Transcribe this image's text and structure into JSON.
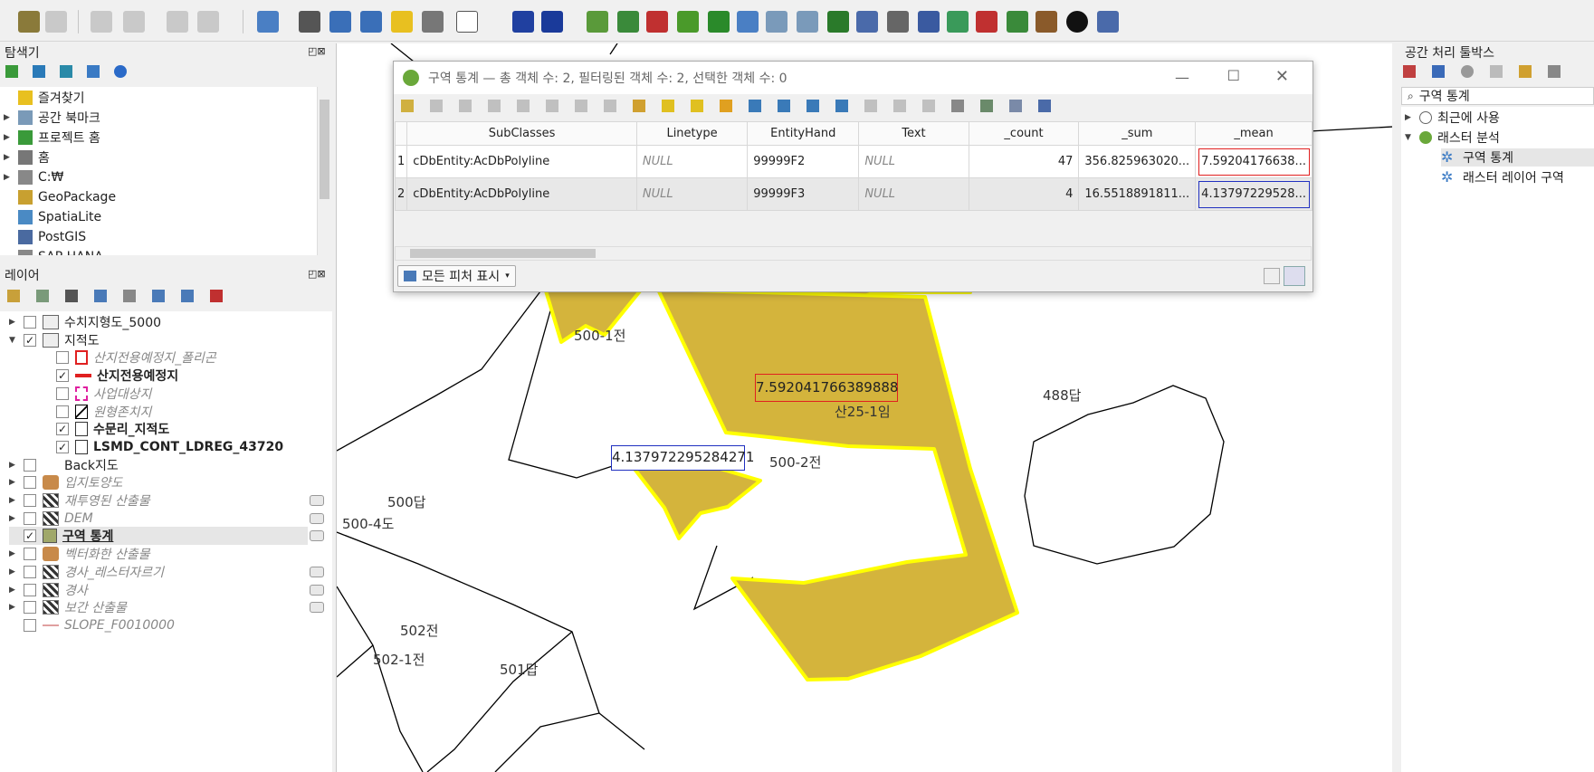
{
  "explorer": {
    "title": "탐색기",
    "items": [
      {
        "label": "즐겨찾기",
        "arrow": ""
      },
      {
        "label": "공간 북마크",
        "arrow": "▶"
      },
      {
        "label": "프로젝트 홈",
        "arrow": "▶"
      },
      {
        "label": "홈",
        "arrow": "▶"
      },
      {
        "label": "C:₩",
        "arrow": "▶"
      },
      {
        "label": "GeoPackage",
        "arrow": ""
      },
      {
        "label": "SpatiaLite",
        "arrow": ""
      },
      {
        "label": "PostGIS",
        "arrow": ""
      },
      {
        "label": "SAP HANA",
        "arrow": ""
      }
    ]
  },
  "layers": {
    "title": "레이어",
    "items": [
      {
        "label": "수치지형도_5000",
        "arrow": "▶",
        "checked": "",
        "indent": 0,
        "style": "normal",
        "icon": "group-icon"
      },
      {
        "label": "지적도",
        "arrow": "▼",
        "checked": "✓",
        "indent": 0,
        "style": "normal",
        "icon": "group-icon"
      },
      {
        "label": "산지전용예정지_폴리곤",
        "arrow": "",
        "checked": "",
        "indent": 1,
        "style": "it",
        "icon": "red-polygon-icon"
      },
      {
        "label": "산지전용예정지",
        "arrow": "",
        "checked": "✓",
        "indent": 1,
        "style": "bold",
        "icon": "red-line-icon"
      },
      {
        "label": "사업대상지",
        "arrow": "",
        "checked": "",
        "indent": 1,
        "style": "it",
        "icon": "pink-dashed-icon"
      },
      {
        "label": "원형존치지",
        "arrow": "",
        "checked": "",
        "indent": 1,
        "style": "it",
        "icon": "hatched-polygon-icon"
      },
      {
        "label": "수문리_지적도",
        "arrow": "",
        "checked": "✓",
        "indent": 1,
        "style": "bold",
        "icon": "empty-polygon-icon"
      },
      {
        "label": "LSMD_CONT_LDREG_43720",
        "arrow": "",
        "checked": "✓",
        "indent": 1,
        "style": "bold",
        "icon": "empty-polygon-icon"
      },
      {
        "label": "Back지도",
        "arrow": "▶",
        "checked": "",
        "indent": 0,
        "style": "normal",
        "icon": "none"
      },
      {
        "label": "입지토양도",
        "arrow": "▶",
        "checked": "",
        "indent": 0,
        "style": "it",
        "icon": "vector-icon"
      },
      {
        "label": "재투영된 산출물",
        "arrow": "▶",
        "checked": "",
        "indent": 0,
        "style": "it",
        "icon": "raster-icon"
      },
      {
        "label": "DEM",
        "arrow": "▶",
        "checked": "",
        "indent": 0,
        "style": "it",
        "icon": "raster-icon"
      },
      {
        "label": "구역 통계",
        "arrow": "",
        "checked": "✓",
        "indent": 0,
        "style": "bold-ul",
        "icon": "olive-fill-icon"
      },
      {
        "label": "벡터화한 산출물",
        "arrow": "▶",
        "checked": "",
        "indent": 0,
        "style": "it",
        "icon": "vector-icon"
      },
      {
        "label": "경사_레스터자르기",
        "arrow": "▶",
        "checked": "",
        "indent": 0,
        "style": "it",
        "icon": "raster-icon"
      },
      {
        "label": "경사",
        "arrow": "▶",
        "checked": "",
        "indent": 0,
        "style": "it",
        "icon": "raster-icon"
      },
      {
        "label": "보간 산출물",
        "arrow": "▶",
        "checked": "",
        "indent": 0,
        "style": "it",
        "icon": "raster-icon"
      },
      {
        "label": "SLOPE_F0010000",
        "arrow": "",
        "checked": "",
        "indent": 0,
        "style": "it",
        "icon": "line-icon"
      }
    ]
  },
  "dialog": {
    "title": "구역 통계 — 총 객체 수: 2, 필터링된 객체 수: 2, 선택한 객체 수: 0",
    "columns": [
      "SubClasses",
      "Linetype",
      "EntityHand",
      "Text",
      "_count",
      "_sum",
      "_mean"
    ],
    "rows": [
      {
        "id": "1",
        "cells": [
          "cDbEntity:AcDbPolyline",
          "NULL",
          "99999F2",
          "NULL",
          "47",
          "356.825963020...",
          "7.59204176638..."
        ]
      },
      {
        "id": "2",
        "cells": [
          "cDbEntity:AcDbPolyline",
          "NULL",
          "99999F3",
          "NULL",
          "4",
          "16.5518891811...",
          "4.13797229528..."
        ]
      }
    ],
    "show_all_label": "모든 피처 표시"
  },
  "map": {
    "labels": [
      {
        "text": "500-1전"
      },
      {
        "text": "산25-1임"
      },
      {
        "text": "500-2전"
      },
      {
        "text": "488답"
      },
      {
        "text": "500답"
      },
      {
        "text": "500-4도"
      },
      {
        "text": "502전"
      },
      {
        "text": "502-1전"
      },
      {
        "text": "501답"
      }
    ],
    "callout_red": "7.592041766389888",
    "callout_blue": "4.137972295284271"
  },
  "toolbox": {
    "title": "공간 처리 툴박스",
    "search": "구역 통계",
    "items": [
      {
        "label": "최근에 사용"
      },
      {
        "label": "래스터 분석"
      },
      {
        "label": "구역 통계"
      },
      {
        "label": "래스터 레이어 구역"
      }
    ]
  },
  "colors": {
    "zone_fill": "#d4b43c",
    "zone_stroke": "#ffff00",
    "red": "#e02020",
    "blue": "#2030c0"
  }
}
